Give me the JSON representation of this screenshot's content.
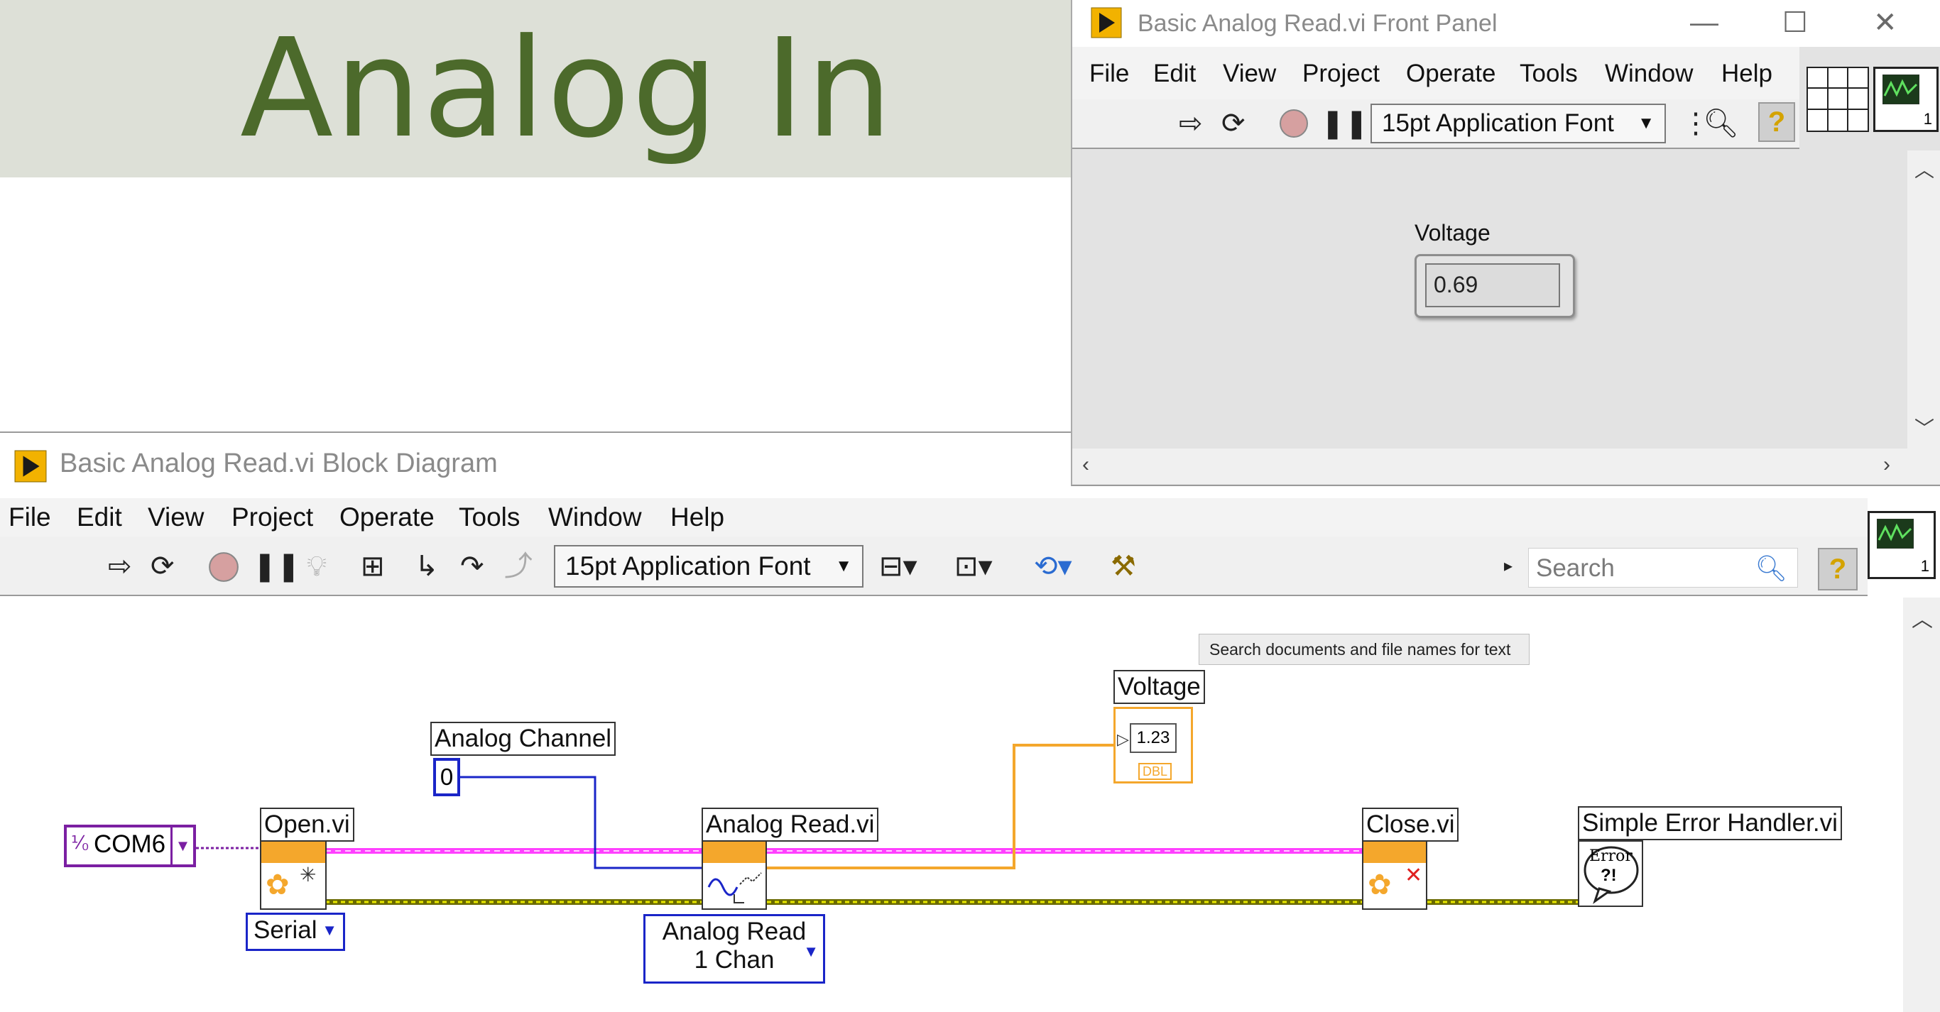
{
  "slide": {
    "title": "Analog In"
  },
  "front_panel": {
    "window_title": "Basic Analog Read.vi Front Panel",
    "menu": [
      "File",
      "Edit",
      "View",
      "Project",
      "Operate",
      "Tools",
      "Window",
      "Help"
    ],
    "font_selector": "15pt Application Font",
    "voltage_label": "Voltage",
    "voltage_value": "0.69",
    "vi_icon_number": "1"
  },
  "block_diagram": {
    "window_title": "Basic Analog Read.vi Block Diagram",
    "menu": [
      "File",
      "Edit",
      "View",
      "Project",
      "Operate",
      "Tools",
      "Window",
      "Help"
    ],
    "font_selector": "15pt Application Font",
    "search_placeholder": "Search",
    "tooltip": "Search documents and file names for text",
    "vi_icon_number": "1",
    "nodes": {
      "com_port": "COM6",
      "open_vi": "Open.vi",
      "serial_enum": "Serial",
      "analog_channel_label": "Analog Channel",
      "analog_channel_value": "0",
      "analog_read_vi": "Analog Read.vi",
      "analog_read_mode_line1": "Analog Read",
      "analog_read_mode_line2": "1 Chan",
      "voltage_label": "Voltage",
      "voltage_indicator": "1.23",
      "voltage_type": "DBL",
      "close_vi": "Close.vi",
      "error_handler_vi": "Simple Error Handler.vi",
      "error_glyph_line1": "Error",
      "error_glyph_line2": "?!"
    }
  },
  "colors": {
    "title_green": "#4c6a2b",
    "title_band": "#dde0d7",
    "wire_pink": "#ff40ff",
    "wire_orange": "#f4a72c",
    "wire_blue": "#1a25c8",
    "wire_error": "#c8c800",
    "visa_purple": "#7b1fa2"
  }
}
